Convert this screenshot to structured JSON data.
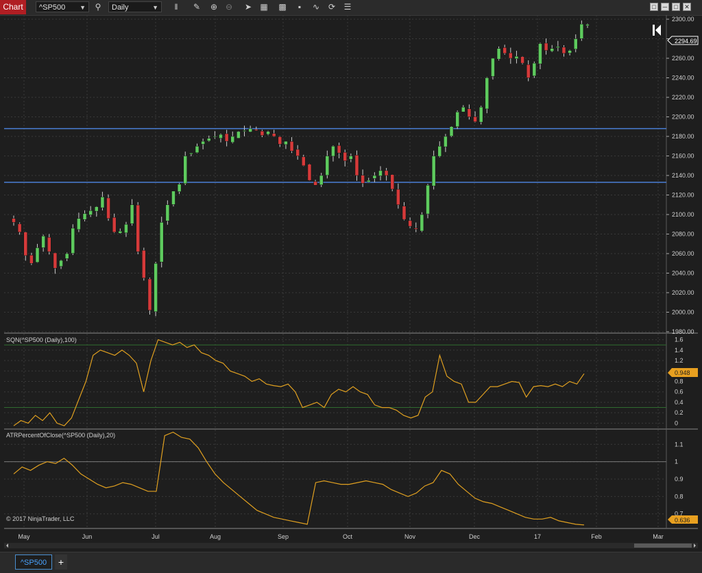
{
  "toolbar": {
    "chart_tab": "Chart",
    "instrument": "^SP500",
    "interval": "Daily",
    "icons": [
      "bar-type-icon",
      "pencil-icon",
      "zoom-in-icon",
      "zoom-out-icon",
      "pointer-icon",
      "properties-icon",
      "strategies-icon",
      "indicators-icon",
      "drawing-tools-icon",
      "refresh-icon",
      "list-icon"
    ]
  },
  "window_buttons": [
    "restore",
    "minimize",
    "maximize",
    "close"
  ],
  "colors": {
    "background": "#1e1e1e",
    "grid": "#3a3a3a",
    "up_candle": "#5ecb5e",
    "down_candle": "#d63a3a",
    "h_line": "#4a7fd6",
    "indicator": "#e0a020",
    "sqn_level": "#2f6b2f",
    "atr_level": "#7a7a7a"
  },
  "price_panel": {
    "current_price": "2294.69",
    "y_ticks": [
      "2300.00",
      "2280.00",
      "2260.00",
      "2240.00",
      "2220.00",
      "2200.00",
      "2180.00",
      "2160.00",
      "2140.00",
      "2120.00",
      "2100.00",
      "2080.00",
      "2060.00",
      "2040.00",
      "2020.00",
      "2000.00",
      "1980.00"
    ],
    "horizontal_lines": [
      2188,
      2133
    ]
  },
  "sqn_panel": {
    "label": "SQN(^SP500 (Daily),100)",
    "current_value": "0.948",
    "y_ticks": [
      "1.6",
      "1.4",
      "1.2",
      "1",
      "0.8",
      "0.6",
      "0.4",
      "0.2",
      "0"
    ],
    "levels": [
      1.5,
      0.3
    ]
  },
  "atr_panel": {
    "label": "ATRPercentOfClose(^SP500 (Daily),20)",
    "current_value": "0.636",
    "y_ticks": [
      "1.1",
      "1",
      "0.9",
      "0.8",
      "0.7"
    ],
    "levels": [
      1.0
    ]
  },
  "copyright": "© 2017 NinjaTrader, LLC",
  "x_axis": {
    "labels": [
      "May",
      "Jun",
      "Jul",
      "Aug",
      "Sep",
      "Oct",
      "Nov",
      "Dec",
      "17",
      "Feb",
      "Mar"
    ]
  },
  "bottom": {
    "instrument_tab": "^SP500",
    "add_tab": "+"
  },
  "chart_data": [
    {
      "type": "candlestick",
      "x": [
        "May",
        "Jun",
        "Jul",
        "Aug",
        "Sep",
        "Oct",
        "Nov",
        "Dec",
        "17",
        "Feb",
        "Mar"
      ],
      "ylim": [
        1980,
        2300
      ],
      "close_path": [
        2092,
        2082,
        2058,
        2050,
        2066,
        2078,
        2062,
        2045,
        2053,
        2060,
        2086,
        2096,
        2101,
        2104,
        2108,
        2118,
        2096,
        2082,
        2083,
        2090,
        2110,
        2062,
        2035,
        2002,
        2050,
        2092,
        2110,
        2124,
        2131,
        2160,
        2163,
        2170,
        2175,
        2178,
        2180,
        2182,
        2175,
        2180,
        2185,
        2186,
        2188,
        2186,
        2181,
        2185,
        2180,
        2172,
        2175,
        2165,
        2160,
        2150,
        2135,
        2130,
        2140,
        2160,
        2170,
        2163,
        2155,
        2160,
        2140,
        2132,
        2135,
        2140,
        2145,
        2140,
        2126,
        2110,
        2095,
        2088,
        2085,
        2100,
        2130,
        2160,
        2170,
        2180,
        2190,
        2205,
        2210,
        2200,
        2195,
        2210,
        2240,
        2260,
        2270,
        2265,
        2260,
        2262,
        2255,
        2240,
        2255,
        2275,
        2268,
        2270,
        2272,
        2265,
        2268,
        2280,
        2295,
        2294.69
      ]
    },
    {
      "type": "line",
      "title": "SQN(^SP500 (Daily),100)",
      "ylim": [
        -0.1,
        1.7
      ],
      "values": [
        -0.05,
        0.05,
        0.0,
        0.15,
        0.05,
        0.2,
        0.0,
        -0.05,
        0.1,
        0.45,
        0.8,
        1.3,
        1.4,
        1.35,
        1.3,
        1.4,
        1.3,
        1.15,
        0.6,
        1.2,
        1.6,
        1.55,
        1.5,
        1.55,
        1.45,
        1.5,
        1.35,
        1.3,
        1.2,
        1.15,
        1.0,
        0.95,
        0.9,
        0.8,
        0.85,
        0.75,
        0.72,
        0.7,
        0.75,
        0.6,
        0.3,
        0.35,
        0.4,
        0.3,
        0.55,
        0.65,
        0.6,
        0.7,
        0.6,
        0.55,
        0.35,
        0.3,
        0.3,
        0.25,
        0.15,
        0.1,
        0.15,
        0.5,
        0.6,
        1.3,
        0.9,
        0.8,
        0.75,
        0.4,
        0.4,
        0.55,
        0.7,
        0.7,
        0.75,
        0.8,
        0.78,
        0.5,
        0.7,
        0.72,
        0.7,
        0.75,
        0.7,
        0.8,
        0.75,
        0.948
      ]
    },
    {
      "type": "line",
      "title": "ATRPercentOfClose(^SP500 (Daily),20)",
      "ylim": [
        0.62,
        1.18
      ],
      "values": [
        0.93,
        0.97,
        0.95,
        0.98,
        1.0,
        0.99,
        1.02,
        0.98,
        0.93,
        0.9,
        0.87,
        0.85,
        0.86,
        0.88,
        0.87,
        0.85,
        0.83,
        0.83,
        1.15,
        1.17,
        1.14,
        1.13,
        1.08,
        1.0,
        0.93,
        0.88,
        0.84,
        0.8,
        0.76,
        0.72,
        0.7,
        0.68,
        0.67,
        0.66,
        0.65,
        0.64,
        0.88,
        0.89,
        0.88,
        0.87,
        0.87,
        0.88,
        0.89,
        0.88,
        0.87,
        0.84,
        0.82,
        0.8,
        0.82,
        0.86,
        0.88,
        0.95,
        0.93,
        0.87,
        0.83,
        0.79,
        0.77,
        0.76,
        0.74,
        0.72,
        0.7,
        0.68,
        0.67,
        0.67,
        0.68,
        0.66,
        0.65,
        0.64,
        0.636
      ]
    }
  ]
}
